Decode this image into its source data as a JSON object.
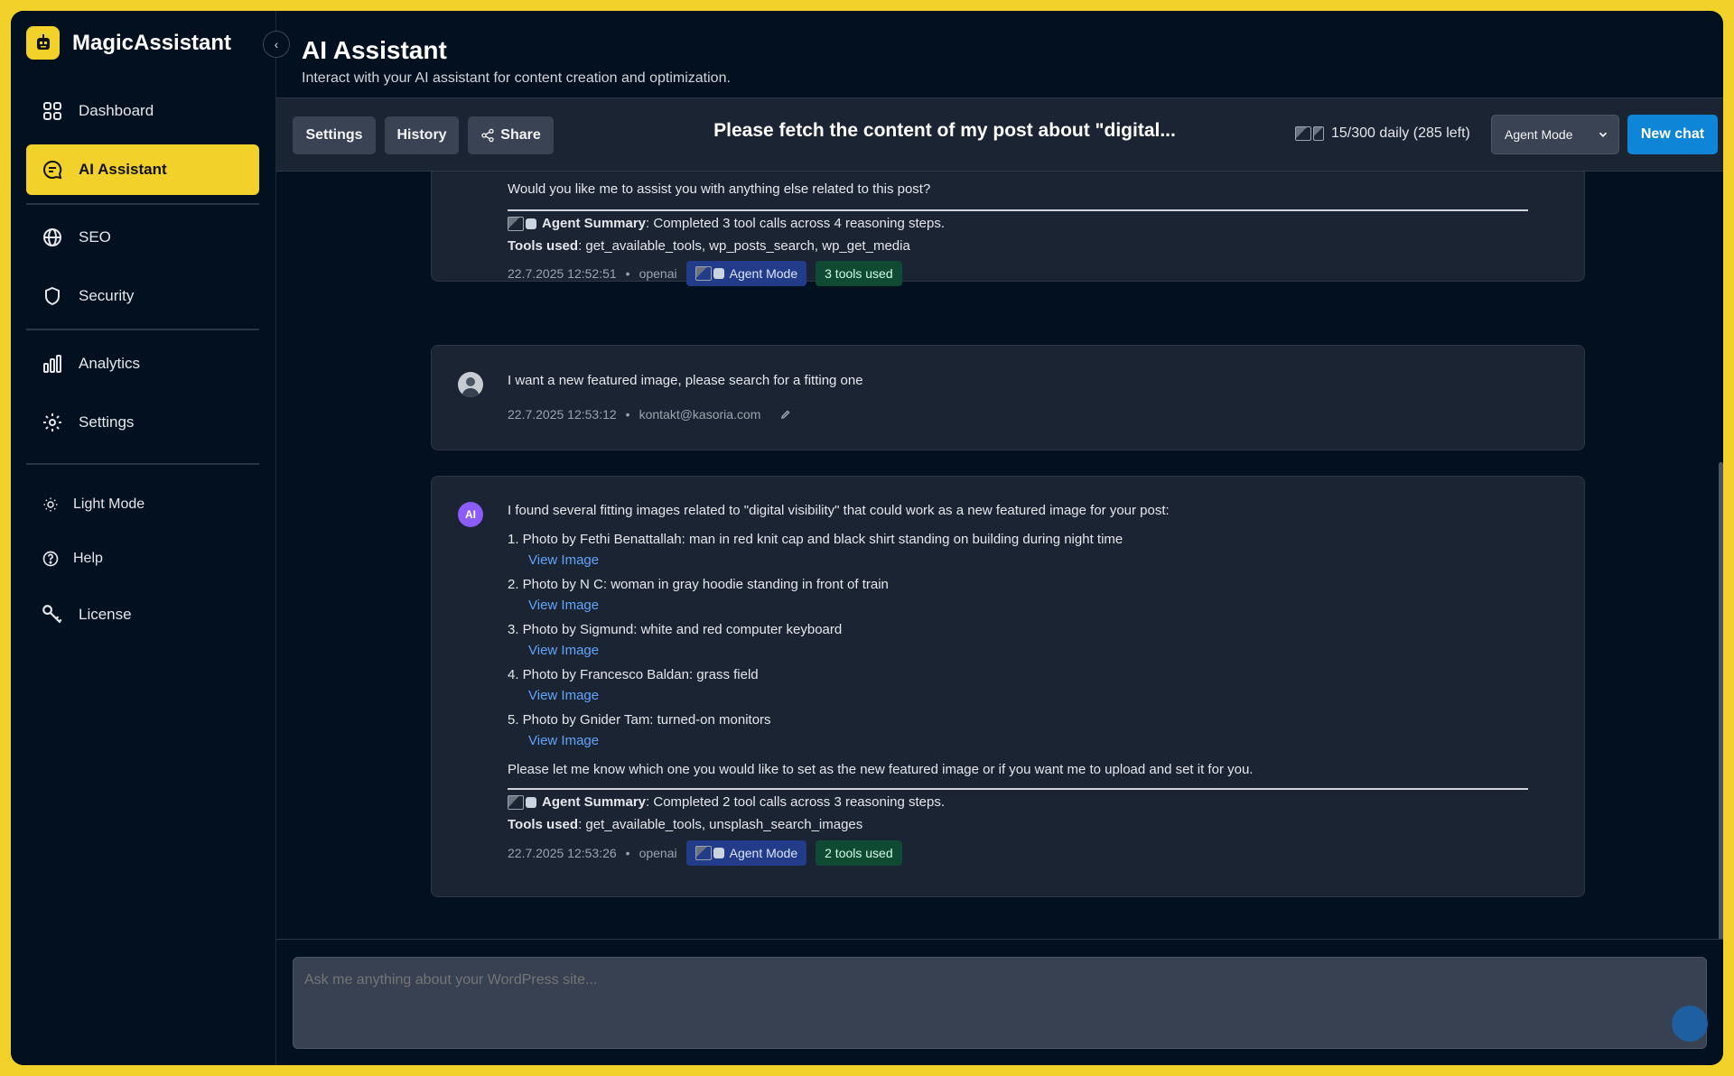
{
  "app": {
    "name": "MagicAssistant"
  },
  "sidebar": {
    "items": [
      {
        "label": "Dashboard"
      },
      {
        "label": "AI Assistant"
      },
      {
        "label": "SEO"
      },
      {
        "label": "Security"
      },
      {
        "label": "Analytics"
      },
      {
        "label": "Settings"
      },
      {
        "label": "Light Mode"
      },
      {
        "label": "Help"
      },
      {
        "label": "License"
      }
    ]
  },
  "header": {
    "title": "AI Assistant",
    "subtitle": "Interact with your AI assistant for content creation and optimization."
  },
  "toolbar": {
    "settings_label": "Settings",
    "history_label": "History",
    "share_label": "Share",
    "chat_title": "Please fetch the content of my post about \"digital...",
    "usage": "15/300 daily (285 left)",
    "mode_selected": "Agent Mode",
    "new_chat_label": "New chat"
  },
  "messages": [
    {
      "role": "assistant",
      "text_tail": "Would you like me to assist you with anything else related to this post?",
      "summary_label": "Agent Summary",
      "summary_text": ": Completed 3 tool calls across 4 reasoning steps.",
      "tools_label": "Tools used",
      "tools_text": ": get_available_tools, wp_posts_search, wp_get_media",
      "timestamp": "22.7.2025 12:52:51",
      "dot": "•",
      "provider": "openai",
      "mode_badge": "Agent Mode",
      "tools_badge": "3 tools used"
    },
    {
      "role": "user",
      "text": "I want a new featured image, please search for a fitting one",
      "timestamp": "22.7.2025 12:53:12",
      "dot": "•",
      "user": "kontakt@kasoria.com"
    },
    {
      "role": "assistant",
      "avatar": "AI",
      "intro": "I found several fitting images related to \"digital visibility\" that could work as a new featured image for your post:",
      "list": [
        {
          "text": "1. Photo by Fethi Benattallah: man in red knit cap and black shirt standing on building during night time",
          "link": "View Image"
        },
        {
          "text": "2. Photo by N C: woman in gray hoodie standing in front of train",
          "link": "View Image"
        },
        {
          "text": "3. Photo by Sigmund: white and red computer keyboard",
          "link": "View Image"
        },
        {
          "text": "4. Photo by Francesco Baldan: grass field",
          "link": "View Image"
        },
        {
          "text": "5. Photo by Gnider Tam: turned-on monitors",
          "link": "View Image"
        }
      ],
      "outro": "Please let me know which one you would like to set as the new featured image or if you want me to upload and set it for you.",
      "summary_label": "Agent Summary",
      "summary_text": ": Completed 2 tool calls across 3 reasoning steps.",
      "tools_label": "Tools used",
      "tools_text": ": get_available_tools, unsplash_search_images",
      "timestamp": "22.7.2025 12:53:26",
      "dot": "•",
      "provider": "openai",
      "mode_badge": "Agent Mode",
      "tools_badge": "2 tools used"
    }
  ],
  "composer": {
    "placeholder": "Ask me anything about your WordPress site..."
  },
  "colors": {
    "accent": "#f2d22a",
    "primary_button": "#0e85d6",
    "background": "#03101f",
    "card": "#1b2433"
  }
}
